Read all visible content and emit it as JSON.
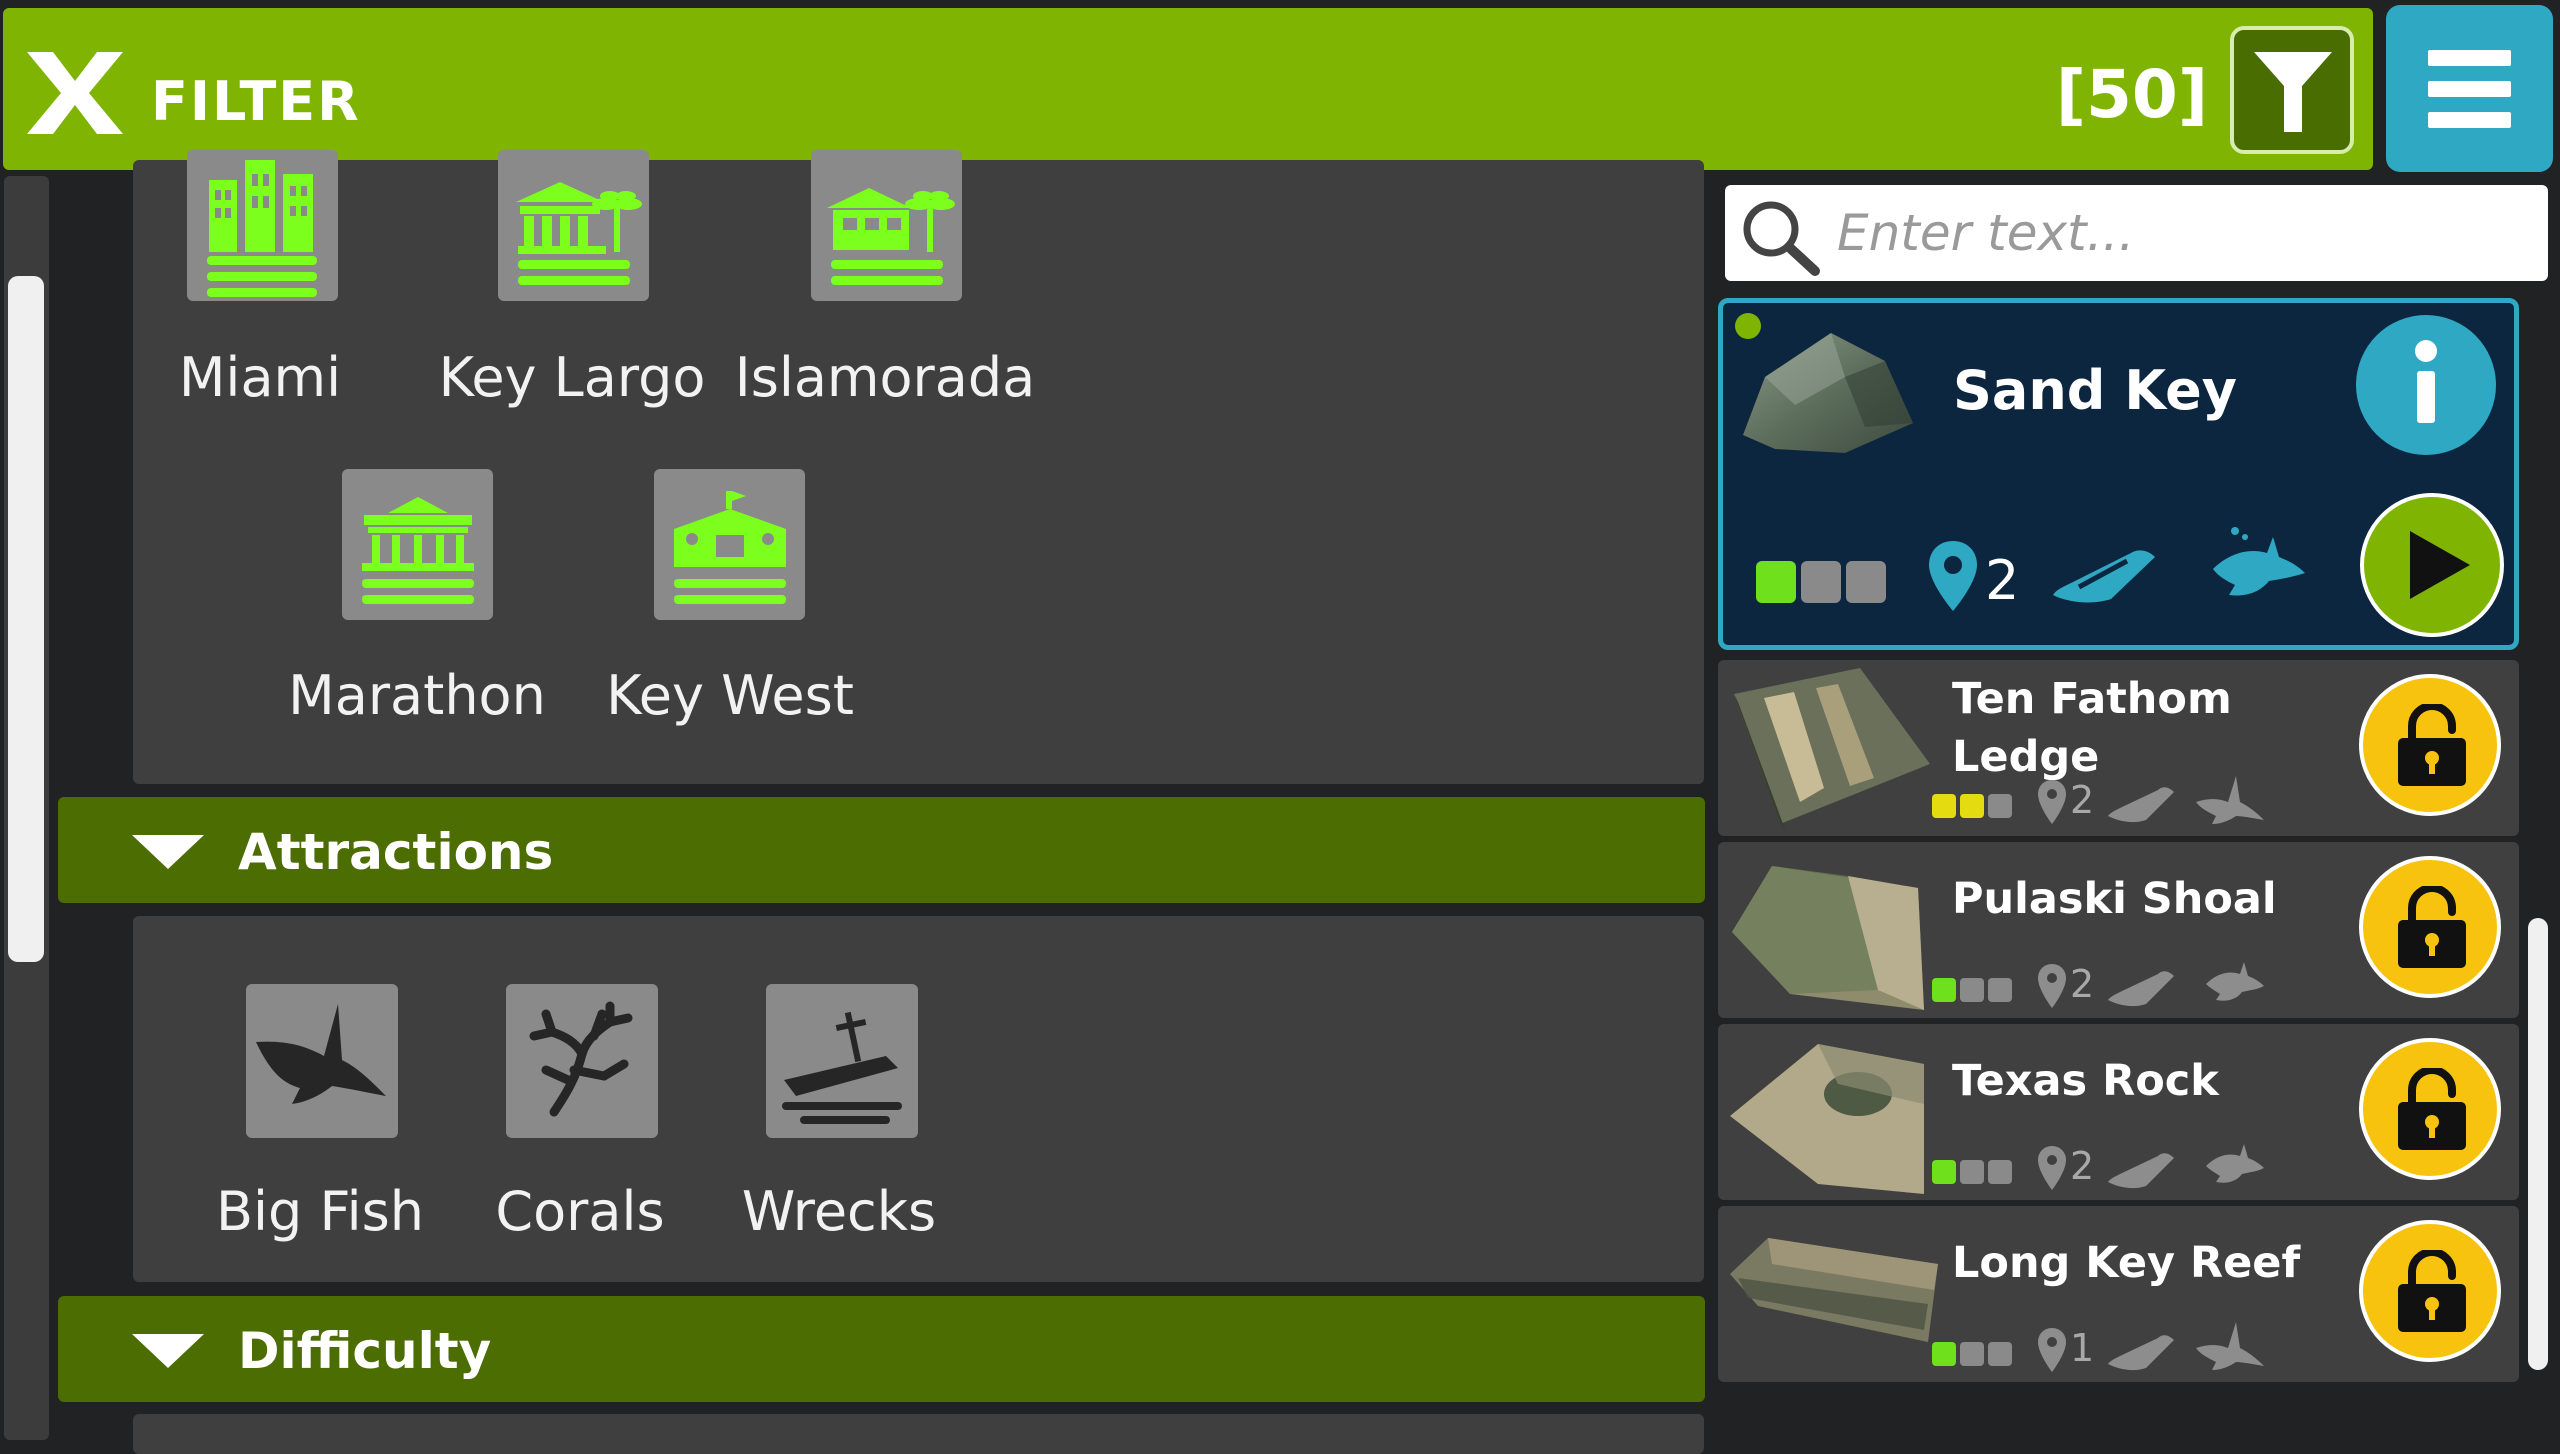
{
  "header": {
    "title": "FILTER",
    "count": "[50]"
  },
  "locations": {
    "items": [
      {
        "label": "Miami",
        "icon": "city-water-icon"
      },
      {
        "label": "Key Largo",
        "icon": "building-palm-water-icon"
      },
      {
        "label": "Islamorada",
        "icon": "house-palm-water-icon"
      },
      {
        "label": "Marathon",
        "icon": "pavilion-water-icon"
      },
      {
        "label": "Key West",
        "icon": "fort-water-icon"
      }
    ]
  },
  "attractions": {
    "header": "Attractions",
    "items": [
      {
        "label": "Big Fish",
        "icon": "shark-icon"
      },
      {
        "label": "Corals",
        "icon": "coral-icon"
      },
      {
        "label": "Wrecks",
        "icon": "shipwreck-icon"
      }
    ]
  },
  "difficulty": {
    "header": "Difficulty"
  },
  "search": {
    "placeholder": "Enter text..."
  },
  "sites": [
    {
      "name": "Sand Key",
      "difficulty": 1,
      "pins": "2",
      "selected": true,
      "creature": "fish-icon"
    },
    {
      "name": "Ten Fathom Ledge",
      "difficulty": 2,
      "pins": "2",
      "locked": true,
      "creature": "shark-icon"
    },
    {
      "name": "Pulaski Shoal",
      "difficulty": 1,
      "pins": "2",
      "locked": true,
      "creature": "fish-icon"
    },
    {
      "name": "Texas Rock",
      "difficulty": 1,
      "pins": "2",
      "locked": true,
      "creature": "fish-icon"
    },
    {
      "name": "Long Key Reef",
      "difficulty": 1,
      "pins": "1",
      "locked": true,
      "creature": "shark-icon"
    }
  ],
  "colors": {
    "topbar": "#7fb402",
    "section_header": "#4b6d01",
    "menu": "#2fa8c3",
    "icon_green": "#7dff1e",
    "lock_yellow": "#f8c30f",
    "diff_green": "#6ee01c",
    "diff_yellow": "#e4dc10"
  }
}
